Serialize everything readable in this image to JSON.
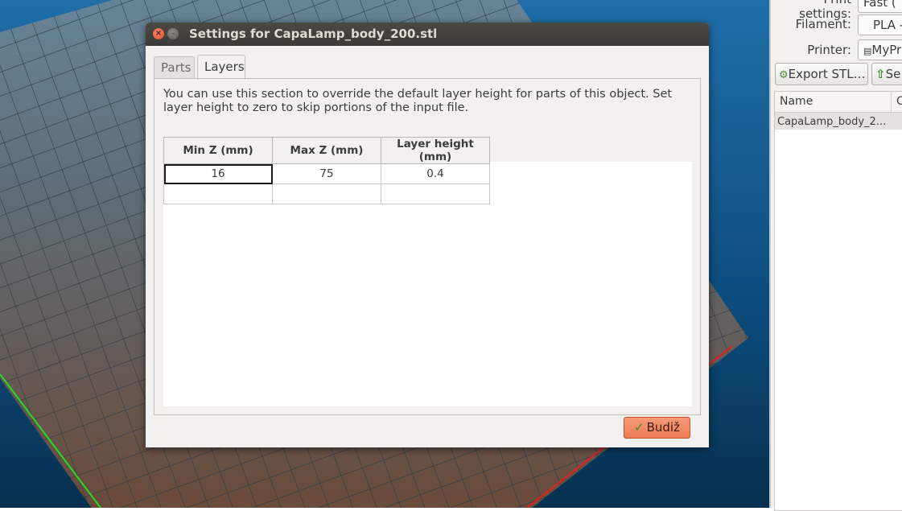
{
  "right_panel": {
    "print_settings_label": "Print settings:",
    "print_settings_value": "Fast (",
    "filament_label": "Filament:",
    "filament_value": "PLA -",
    "printer_label": "Printer:",
    "printer_value": "MyPr",
    "export_stl_label": "Export STL…",
    "send_label": "Se",
    "list_columns": [
      "Name",
      "C"
    ],
    "list_rows": [
      "CapaLamp_body_2..."
    ]
  },
  "dialog": {
    "title": "Settings for CapaLamp_body_200.stl",
    "close_glyph": "×",
    "minimize_glyph": "–",
    "tabs": [
      "Parts",
      "Layers"
    ],
    "active_tab": "Layers",
    "description": "You can use this section to override the default layer height for parts of this object. Set layer height to zero to skip portions of the input file.",
    "table": {
      "headers": [
        "Min Z (mm)",
        "Max Z (mm)",
        "Layer height (mm)"
      ],
      "rows": [
        [
          "16",
          "75",
          "0.4"
        ],
        [
          "",
          "",
          ""
        ]
      ]
    },
    "ok_button_label": "Budiž"
  },
  "colors": {
    "accent_button": "#ee7c55",
    "titlebar": "#3b3a36",
    "viewport_bg": "#0d4f82"
  }
}
